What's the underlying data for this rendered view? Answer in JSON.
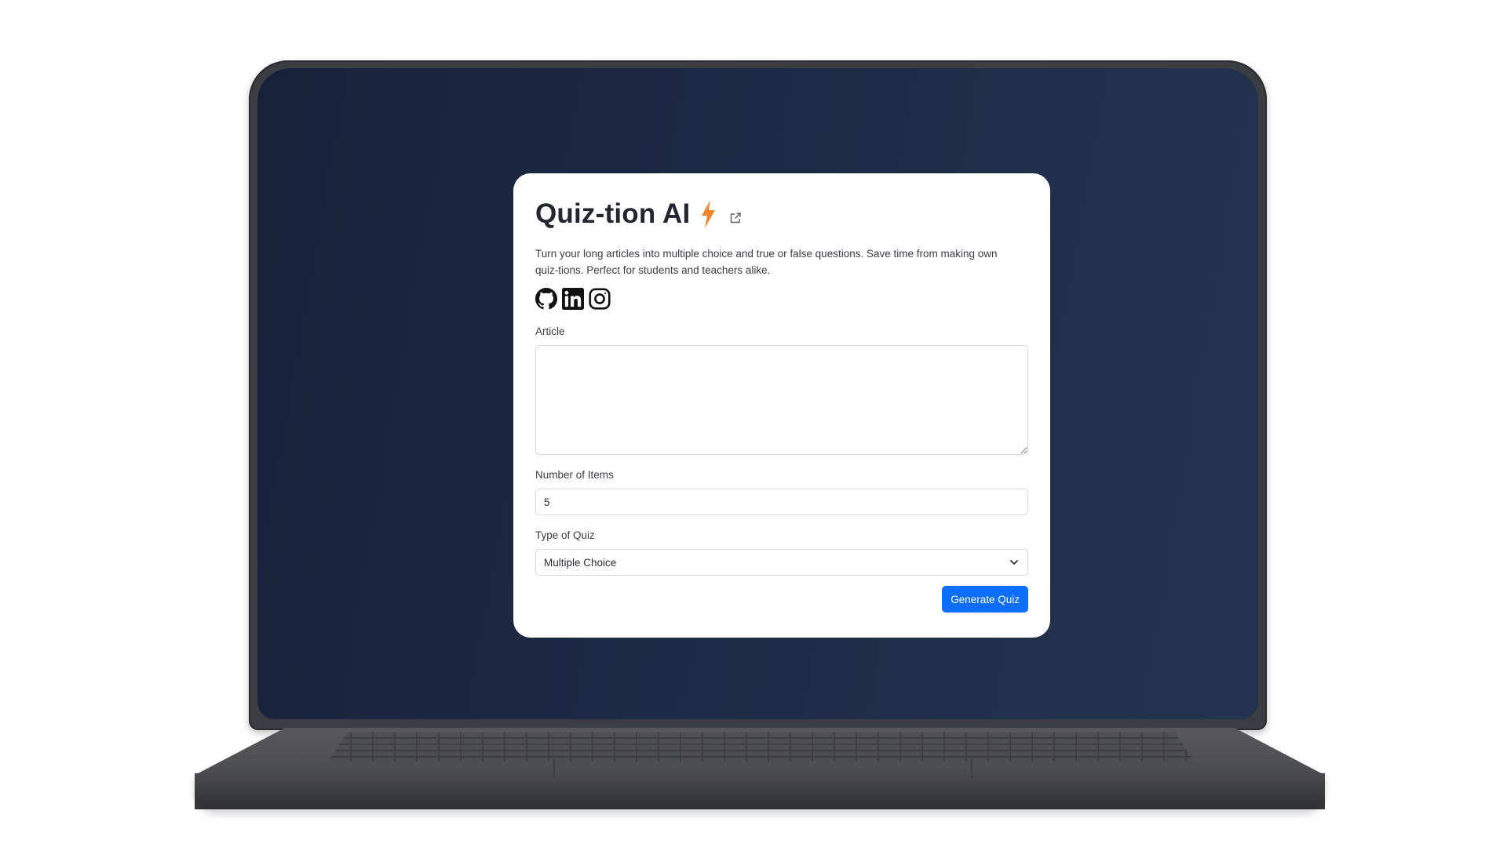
{
  "app": {
    "title": "Quiz-tion AI",
    "description": "Turn your long articles into multiple choice and true or false questions. Save time from making own quiz-tions. Perfect for students and teachers alike.",
    "title_icon": "lightning-bolt-icon",
    "title_link_icon": "external-link-icon"
  },
  "socials": [
    {
      "name": "github-icon"
    },
    {
      "name": "linkedin-icon"
    },
    {
      "name": "instagram-icon"
    }
  ],
  "form": {
    "article": {
      "label": "Article",
      "value": "",
      "placeholder": ""
    },
    "items": {
      "label": "Number of Items",
      "value": "5"
    },
    "quiz_type": {
      "label": "Type of Quiz",
      "selected": "Multiple Choice"
    },
    "submit_label": "Generate Quiz"
  },
  "colors": {
    "accent": "#0d6efd",
    "bolt": "#f5842b",
    "screen_background": "#1d2a45"
  }
}
